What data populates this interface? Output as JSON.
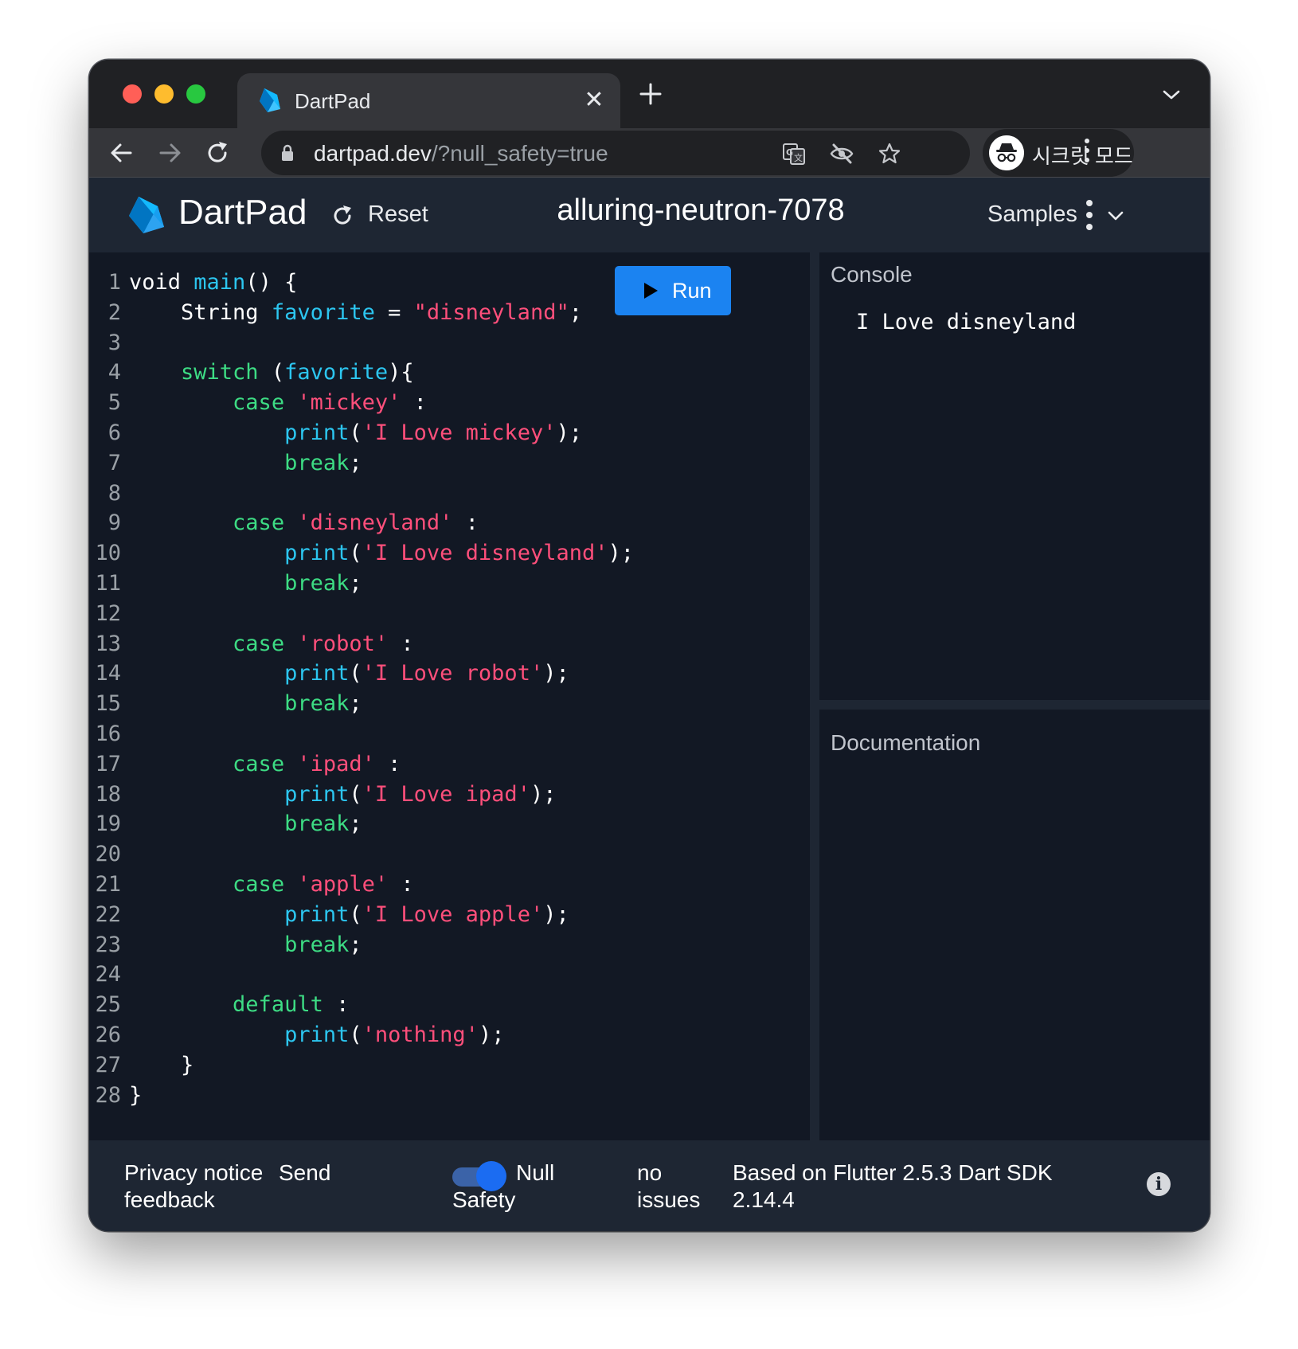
{
  "browser": {
    "tab_title": "DartPad",
    "tab_close": "✕",
    "url_host": "dartpad.dev",
    "url_path": "/?null_safety=true",
    "profile_label": "시크릿 모드"
  },
  "app": {
    "brand": "DartPad",
    "reset_label": "Reset",
    "pad_name": "alluring-neutron-7078",
    "samples_label": "Samples",
    "run_label": "Run"
  },
  "code_lines": [
    {
      "n": "1",
      "tokens": [
        {
          "t": "void ",
          "c": ""
        },
        {
          "t": "main",
          "c": "f"
        },
        {
          "t": "() {",
          "c": ""
        }
      ]
    },
    {
      "n": "2",
      "tokens": [
        {
          "t": "    String ",
          "c": ""
        },
        {
          "t": "favorite",
          "c": "f"
        },
        {
          "t": " = ",
          "c": ""
        },
        {
          "t": "\"disneyland\"",
          "c": "s"
        },
        {
          "t": ";",
          "c": ""
        }
      ]
    },
    {
      "n": "3",
      "tokens": []
    },
    {
      "n": "4",
      "tokens": [
        {
          "t": "    ",
          "c": ""
        },
        {
          "t": "switch",
          "c": "k"
        },
        {
          "t": " (",
          "c": ""
        },
        {
          "t": "favorite",
          "c": "f"
        },
        {
          "t": "){",
          "c": ""
        }
      ]
    },
    {
      "n": "5",
      "tokens": [
        {
          "t": "        ",
          "c": ""
        },
        {
          "t": "case",
          "c": "k"
        },
        {
          "t": " ",
          "c": ""
        },
        {
          "t": "'mickey'",
          "c": "s"
        },
        {
          "t": " :",
          "c": ""
        }
      ]
    },
    {
      "n": "6",
      "tokens": [
        {
          "t": "            ",
          "c": ""
        },
        {
          "t": "print",
          "c": "f"
        },
        {
          "t": "(",
          "c": ""
        },
        {
          "t": "'I Love mickey'",
          "c": "s"
        },
        {
          "t": ");",
          "c": ""
        }
      ]
    },
    {
      "n": "7",
      "tokens": [
        {
          "t": "            ",
          "c": ""
        },
        {
          "t": "break",
          "c": "k"
        },
        {
          "t": ";",
          "c": ""
        }
      ]
    },
    {
      "n": "8",
      "tokens": []
    },
    {
      "n": "9",
      "tokens": [
        {
          "t": "        ",
          "c": ""
        },
        {
          "t": "case",
          "c": "k"
        },
        {
          "t": " ",
          "c": ""
        },
        {
          "t": "'disneyland'",
          "c": "s"
        },
        {
          "t": " :",
          "c": ""
        }
      ]
    },
    {
      "n": "10",
      "tokens": [
        {
          "t": "            ",
          "c": ""
        },
        {
          "t": "print",
          "c": "f"
        },
        {
          "t": "(",
          "c": ""
        },
        {
          "t": "'I Love disneyland'",
          "c": "s"
        },
        {
          "t": ");",
          "c": ""
        }
      ]
    },
    {
      "n": "11",
      "tokens": [
        {
          "t": "            ",
          "c": ""
        },
        {
          "t": "break",
          "c": "k"
        },
        {
          "t": ";",
          "c": ""
        }
      ]
    },
    {
      "n": "12",
      "tokens": []
    },
    {
      "n": "13",
      "tokens": [
        {
          "t": "        ",
          "c": ""
        },
        {
          "t": "case",
          "c": "k"
        },
        {
          "t": " ",
          "c": ""
        },
        {
          "t": "'robot'",
          "c": "s"
        },
        {
          "t": " :",
          "c": ""
        }
      ]
    },
    {
      "n": "14",
      "tokens": [
        {
          "t": "            ",
          "c": ""
        },
        {
          "t": "print",
          "c": "f"
        },
        {
          "t": "(",
          "c": ""
        },
        {
          "t": "'I Love robot'",
          "c": "s"
        },
        {
          "t": ");",
          "c": ""
        }
      ]
    },
    {
      "n": "15",
      "tokens": [
        {
          "t": "            ",
          "c": ""
        },
        {
          "t": "break",
          "c": "k"
        },
        {
          "t": ";",
          "c": ""
        }
      ]
    },
    {
      "n": "16",
      "tokens": []
    },
    {
      "n": "17",
      "tokens": [
        {
          "t": "        ",
          "c": ""
        },
        {
          "t": "case",
          "c": "k"
        },
        {
          "t": " ",
          "c": ""
        },
        {
          "t": "'ipad'",
          "c": "s"
        },
        {
          "t": " :",
          "c": ""
        }
      ]
    },
    {
      "n": "18",
      "tokens": [
        {
          "t": "            ",
          "c": ""
        },
        {
          "t": "print",
          "c": "f"
        },
        {
          "t": "(",
          "c": ""
        },
        {
          "t": "'I Love ipad'",
          "c": "s"
        },
        {
          "t": ");",
          "c": ""
        }
      ]
    },
    {
      "n": "19",
      "tokens": [
        {
          "t": "            ",
          "c": ""
        },
        {
          "t": "break",
          "c": "k"
        },
        {
          "t": ";",
          "c": ""
        }
      ]
    },
    {
      "n": "20",
      "tokens": []
    },
    {
      "n": "21",
      "tokens": [
        {
          "t": "        ",
          "c": ""
        },
        {
          "t": "case",
          "c": "k"
        },
        {
          "t": " ",
          "c": ""
        },
        {
          "t": "'apple'",
          "c": "s"
        },
        {
          "t": " :",
          "c": ""
        }
      ]
    },
    {
      "n": "22",
      "tokens": [
        {
          "t": "            ",
          "c": ""
        },
        {
          "t": "print",
          "c": "f"
        },
        {
          "t": "(",
          "c": ""
        },
        {
          "t": "'I Love apple'",
          "c": "s"
        },
        {
          "t": ");",
          "c": ""
        }
      ]
    },
    {
      "n": "23",
      "tokens": [
        {
          "t": "            ",
          "c": ""
        },
        {
          "t": "break",
          "c": "k"
        },
        {
          "t": ";",
          "c": ""
        }
      ]
    },
    {
      "n": "24",
      "tokens": []
    },
    {
      "n": "25",
      "tokens": [
        {
          "t": "        ",
          "c": ""
        },
        {
          "t": "default",
          "c": "k"
        },
        {
          "t": " :",
          "c": ""
        }
      ]
    },
    {
      "n": "26",
      "tokens": [
        {
          "t": "            ",
          "c": ""
        },
        {
          "t": "print",
          "c": "f"
        },
        {
          "t": "(",
          "c": ""
        },
        {
          "t": "'nothing'",
          "c": "s"
        },
        {
          "t": ");",
          "c": ""
        }
      ]
    },
    {
      "n": "27",
      "tokens": [
        {
          "t": "    }",
          "c": ""
        }
      ]
    },
    {
      "n": "28",
      "tokens": [
        {
          "t": "}",
          "c": ""
        }
      ]
    }
  ],
  "console": {
    "title": "Console",
    "output": "I Love disneyland"
  },
  "documentation": {
    "title": "Documentation"
  },
  "footer": {
    "privacy_line1": "Privacy notice",
    "privacy_line2": "feedback",
    "send": "Send",
    "null_line1": "Null",
    "null_line2": "Safety",
    "null_safety_on": true,
    "issues_line1": "no",
    "issues_line2": "issues",
    "sdk_line1": "Based on Flutter 2.5.3 Dart SDK",
    "sdk_line2": "2.14.4",
    "info_glyph": "i"
  },
  "colors": {
    "keyword": "#3ddc84",
    "identifier": "#2cc6f0",
    "string": "#ff4f7b",
    "run_button": "#1b83f1",
    "editor_bg": "#121824",
    "header_bg": "#1e2633"
  }
}
